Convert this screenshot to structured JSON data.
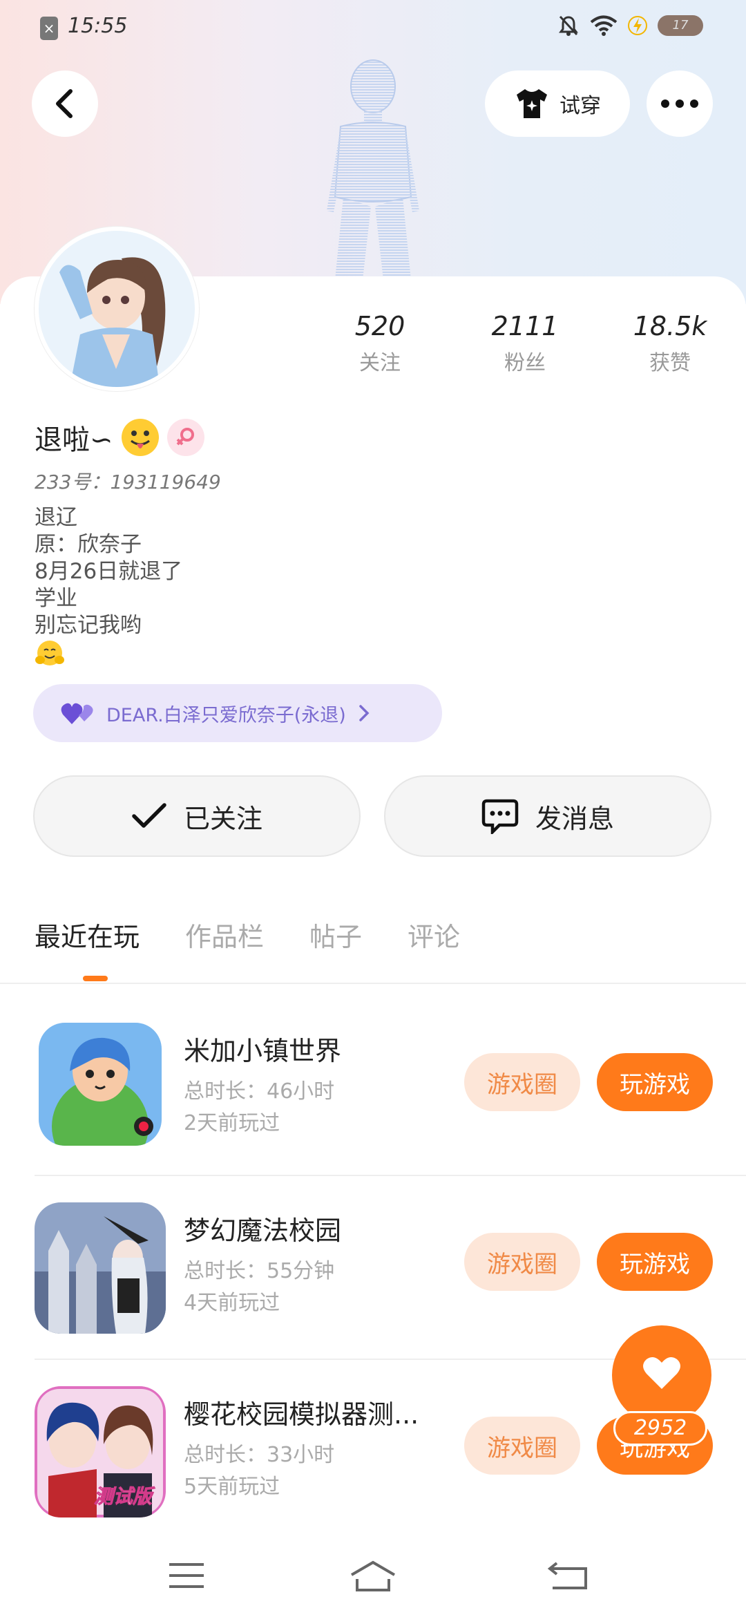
{
  "status_bar": {
    "time": "15:55",
    "battery": "17",
    "close_glyph": "×"
  },
  "header": {
    "try_on_label": "试穿",
    "more_icon": "more-icon",
    "back_icon": "back-icon"
  },
  "profile": {
    "stats": [
      {
        "value": "520",
        "label": "关注"
      },
      {
        "value": "2111",
        "label": "粉丝"
      },
      {
        "value": "18.5k",
        "label": "获赞"
      }
    ],
    "nickname": "退啦∽",
    "uid": "233号：193119649",
    "bio_lines": [
      "退辽",
      "原：欣奈子",
      "8月26日就退了",
      "学业",
      "别忘记我哟"
    ],
    "dear_text": "DEAR.白泽只爱欣奈子(永退)",
    "follow_label": "已关注",
    "message_label": "发消息"
  },
  "tabs": [
    {
      "label": "最近在玩",
      "active": true
    },
    {
      "label": "作品栏",
      "active": false
    },
    {
      "label": "帖子",
      "active": false
    },
    {
      "label": "评论",
      "active": false
    }
  ],
  "games": [
    {
      "name": "米加小镇世界",
      "total_time": "总时长：46小时",
      "last_played": "2天前玩过",
      "circle_label": "游戏圈",
      "play_label": "玩游戏"
    },
    {
      "name": "梦幻魔法校园",
      "total_time": "总时长：55分钟",
      "last_played": "4天前玩过",
      "circle_label": "游戏圈",
      "play_label": "玩游戏"
    },
    {
      "name": "樱花校园模拟器测...",
      "total_time": "总时长：33小时",
      "last_played": "5天前玩过",
      "circle_label": "游戏圈",
      "play_label": "玩游戏"
    }
  ],
  "game3_badge": "测试版",
  "like_fab": {
    "count": "2952"
  },
  "colors": {
    "accent": "#ff7a1a",
    "accent_light": "#fde6d8",
    "dear_bg": "#ebe7fa",
    "dear_text": "#7a6bd0"
  }
}
